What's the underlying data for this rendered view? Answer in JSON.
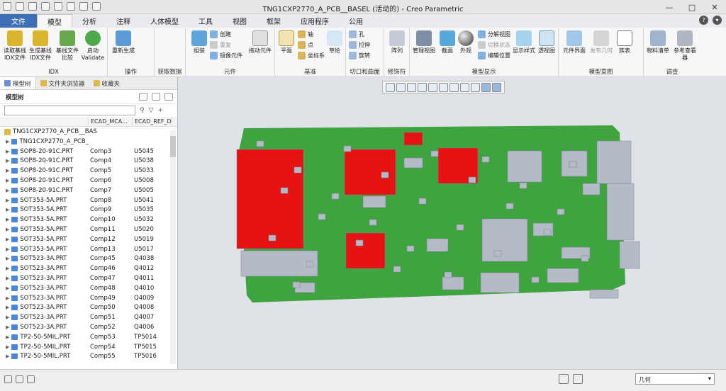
{
  "window": {
    "title": "TNG1CXP2770_A_PCB__BASEL (活动的) - Creo Parametric"
  },
  "tabs": [
    "文件",
    "模型",
    "分析",
    "注释",
    "人体模型",
    "工具",
    "视图",
    "框架",
    "应用程序",
    "公用"
  ],
  "ribbon": {
    "idx": {
      "label": "IDX",
      "buttons": [
        "读取基线\nIDX文件",
        "生成基线\nIDX文件",
        "基线文件\n比较",
        "启动\nValidate"
      ]
    },
    "ops": {
      "label": "操作",
      "regen": "重新生成"
    },
    "getdata": {
      "label": "获取数据"
    },
    "component": {
      "label": "元件",
      "assemble": "组装",
      "create": "创建",
      "repeat": "重复",
      "mirror": "镜像元件",
      "drag": "拖动元件"
    },
    "datum": {
      "label": "基准",
      "plane": "平面",
      "axis": "轴",
      "point": "点",
      "csys": "坐标系",
      "sketch": "草绘"
    },
    "cut": {
      "label": "切口和曲面",
      "hole": "孔",
      "extrude": "拉伸",
      "revolve": "旋转"
    },
    "modifier": {
      "label": "修饰符",
      "pattern": "阵列"
    },
    "display": {
      "label": "模型显示",
      "manage": "管理视图",
      "section": "截面",
      "appearance": "外观",
      "explode": "分解视图",
      "toggle": "切换状态",
      "editpos": "编辑位置",
      "style": "显示样式",
      "persp": "透视图"
    },
    "intent": {
      "label": "模型意图",
      "interface": "元件界面",
      "publish": "发布几何",
      "table": "族表"
    },
    "investigate": {
      "label": "调查",
      "bom": "物料清单",
      "refviewer": "参考查看器"
    }
  },
  "panel": {
    "tabs": [
      "模型树",
      "文件夹浏览器",
      "收藏夹"
    ],
    "title": "模型树",
    "columns": [
      "",
      "ECAD_MCA...",
      "ECAD_REF_D..."
    ],
    "root": "TNG1CXP2770_A_PCB__BAS",
    "rows": [
      {
        "name": "TNG1CXP2770_A_PCB_",
        "val": "",
        "ref": ""
      },
      {
        "name": "SOP8-20-91C.PRT",
        "val": "Comp3",
        "ref": "U5045"
      },
      {
        "name": "SOP8-20-91C.PRT",
        "val": "Comp4",
        "ref": "U5038"
      },
      {
        "name": "SOP8-20-91C.PRT",
        "val": "Comp5",
        "ref": "U5033"
      },
      {
        "name": "SOP8-20-91C.PRT",
        "val": "Comp6",
        "ref": "U5008"
      },
      {
        "name": "SOP8-20-91C.PRT",
        "val": "Comp7",
        "ref": "U5005"
      },
      {
        "name": "SOT353-5A.PRT",
        "val": "Comp8",
        "ref": "U5041"
      },
      {
        "name": "SOT353-5A.PRT",
        "val": "Comp9",
        "ref": "U5035"
      },
      {
        "name": "SOT353-5A.PRT",
        "val": "Comp10",
        "ref": "U5032"
      },
      {
        "name": "SOT353-5A.PRT",
        "val": "Comp11",
        "ref": "U5020"
      },
      {
        "name": "SOT353-5A.PRT",
        "val": "Comp12",
        "ref": "U5019"
      },
      {
        "name": "SOT353-5A.PRT",
        "val": "Comp13",
        "ref": "U5017"
      },
      {
        "name": "SOT523-3A.PRT",
        "val": "Comp45",
        "ref": "Q4038"
      },
      {
        "name": "SOT523-3A.PRT",
        "val": "Comp46",
        "ref": "Q4012"
      },
      {
        "name": "SOT523-3A.PRT",
        "val": "Comp47",
        "ref": "Q4011"
      },
      {
        "name": "SOT523-3A.PRT",
        "val": "Comp48",
        "ref": "Q4010"
      },
      {
        "name": "SOT523-3A.PRT",
        "val": "Comp49",
        "ref": "Q4009"
      },
      {
        "name": "SOT523-3A.PRT",
        "val": "Comp50",
        "ref": "Q4008"
      },
      {
        "name": "SOT523-3A.PRT",
        "val": "Comp51",
        "ref": "Q4007"
      },
      {
        "name": "SOT523-3A.PRT",
        "val": "Comp52",
        "ref": "Q4006"
      },
      {
        "name": "TP2-50-5MIL.PRT",
        "val": "Comp53",
        "ref": "TP5014"
      },
      {
        "name": "TP2-50-5MIL.PRT",
        "val": "Comp54",
        "ref": "TP5015"
      },
      {
        "name": "TP2-50-5MIL.PRT",
        "val": "Comp55",
        "ref": "TP5016"
      }
    ]
  },
  "status": {
    "filter": "几何"
  },
  "colors": {
    "board": "#3fa43f",
    "part": "#b4bac6",
    "highlight": "#e51313",
    "file_tab": "#3d6fb6"
  }
}
